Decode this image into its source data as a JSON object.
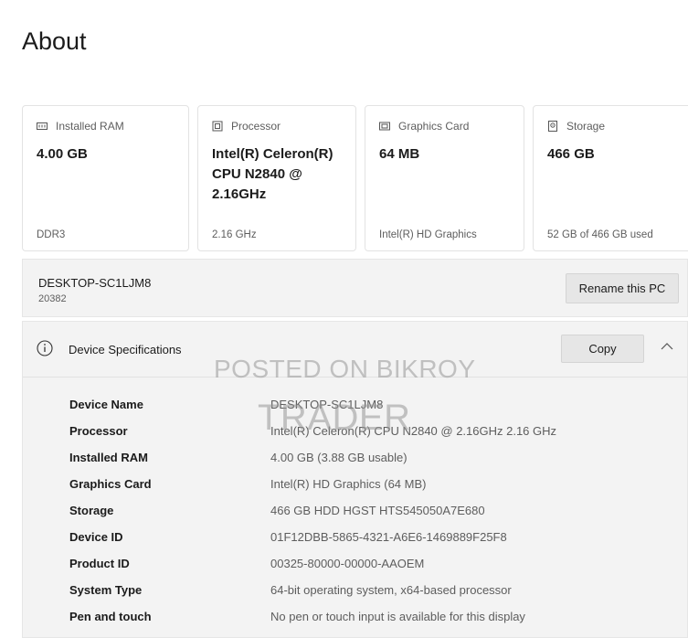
{
  "page": {
    "title": "About"
  },
  "cards": [
    {
      "icon": "ram-icon",
      "label": "Installed RAM",
      "value": "4.00 GB",
      "footer": "DDR3"
    },
    {
      "icon": "processor-icon",
      "label": "Processor",
      "value": "Intel(R) Celeron(R) CPU  N2840  @ 2.16GHz",
      "footer": "2.16 GHz"
    },
    {
      "icon": "graphics-card-icon",
      "label": "Graphics Card",
      "value": "64 MB",
      "footer": "Intel(R) HD Graphics"
    },
    {
      "icon": "storage-icon",
      "label": "Storage",
      "value": "466 GB",
      "footer": "52 GB of 466 GB used"
    }
  ],
  "pc": {
    "name": "DESKTOP-SC1LJM8",
    "sub": "20382",
    "rename_label": "Rename this PC"
  },
  "specs": {
    "title": "Device Specifications",
    "copy_label": "Copy",
    "rows": [
      {
        "key": "Device Name",
        "value": "DESKTOP-SC1LJM8"
      },
      {
        "key": "Processor",
        "value": "Intel(R) Celeron(R) CPU  N2840  @ 2.16GHz   2.16 GHz"
      },
      {
        "key": "Installed RAM",
        "value": "4.00 GB (3.88 GB usable)"
      },
      {
        "key": "Graphics Card",
        "value": "Intel(R) HD Graphics (64 MB)"
      },
      {
        "key": "Storage",
        "value": "466 GB HDD HGST HTS545050A7E680"
      },
      {
        "key": "Device ID",
        "value": "01F12DBB-5865-4321-A6E6-1469889F25F8"
      },
      {
        "key": "Product ID",
        "value": "00325-80000-00000-AAOEM"
      },
      {
        "key": "System Type",
        "value": "64-bit operating system, x64-based processor"
      },
      {
        "key": "Pen and touch",
        "value": "No pen or touch input is available for this display"
      }
    ]
  },
  "watermark": {
    "line1": "POSTED ON BIKROY",
    "line2": "TRADER"
  }
}
